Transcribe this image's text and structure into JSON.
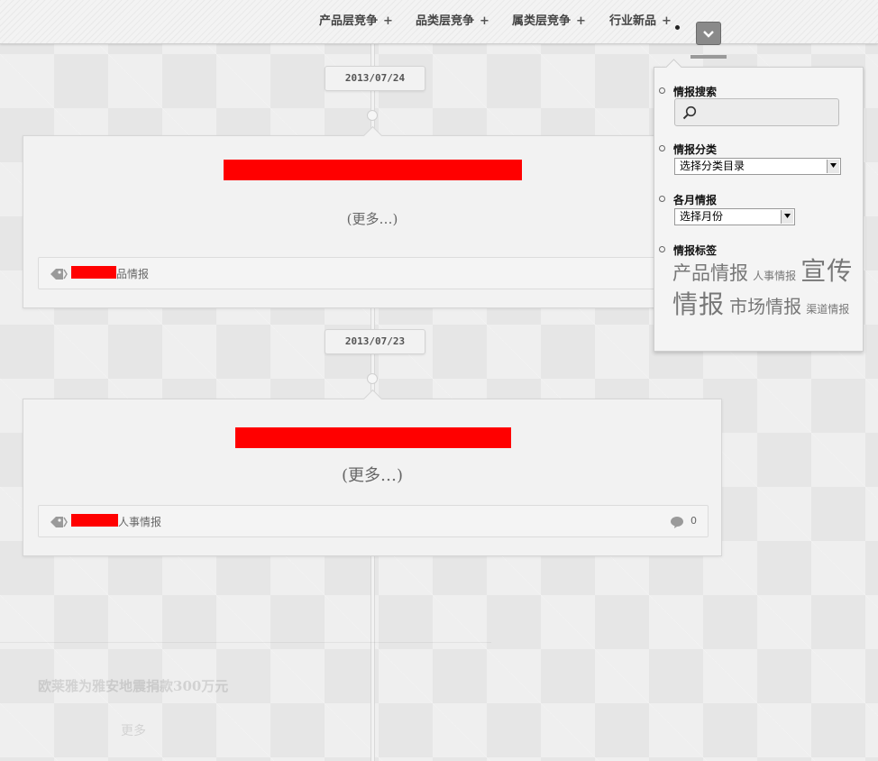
{
  "nav": {
    "items": [
      {
        "label": "产品层竞争",
        "plus": "+"
      },
      {
        "label": "品类层竞争",
        "plus": "+"
      },
      {
        "label": "属类层竞争",
        "plus": "+"
      },
      {
        "label": "行业新品",
        "plus": "+"
      }
    ],
    "menu_icon": "chevron-down-icon"
  },
  "timeline": {
    "posts": [
      {
        "date": "2013/07/24",
        "more": "(更多…)",
        "tag_suffix": "品情报"
      },
      {
        "date": "2013/07/23",
        "more": "(更多…)",
        "tag_suffix": "人事情报",
        "comments": "0"
      }
    ],
    "faded_post": {
      "title": "欧莱雅为雅安地震捐款300万元",
      "more": "更多"
    }
  },
  "panel": {
    "search": {
      "heading": "情报搜索",
      "icon": "search-icon"
    },
    "category": {
      "heading": "情报分类",
      "selected": "选择分类目录"
    },
    "monthly": {
      "heading": "各月情报",
      "selected": "选择月份"
    },
    "tags": {
      "heading": "情报标签",
      "items": [
        "产品情报",
        "人事情报",
        "宣传情报",
        "市场情报",
        "渠道情报"
      ]
    }
  },
  "colors": {
    "redaction": "#ff0000",
    "accent_button": "#8a8a8a"
  }
}
